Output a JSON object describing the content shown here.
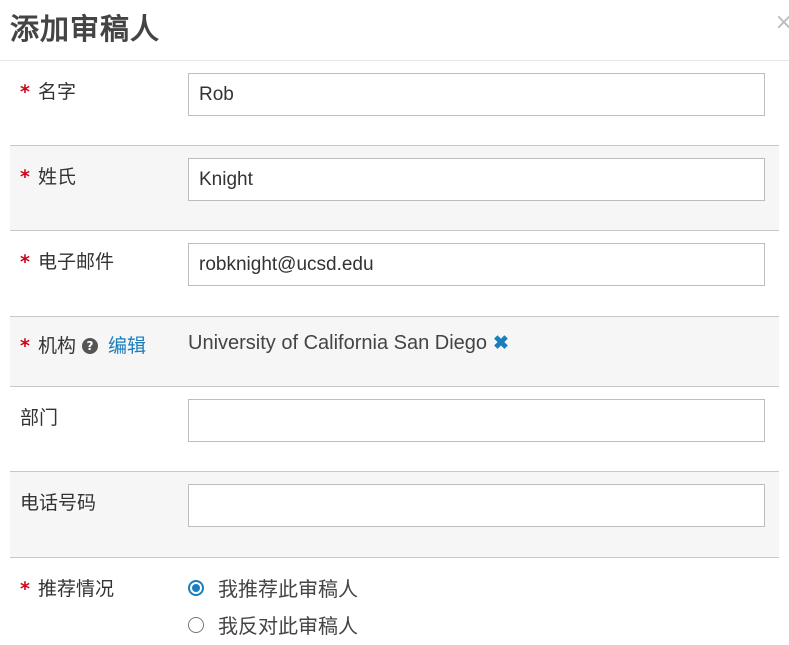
{
  "dialog": {
    "title": "添加审稿人",
    "close_glyph": "×"
  },
  "required_mark": "*",
  "fields": {
    "first_name": {
      "label": "名字",
      "value": "Rob"
    },
    "last_name": {
      "label": "姓氏",
      "value": "Knight"
    },
    "email": {
      "label": "电子邮件",
      "value": "robknight@ucsd.edu"
    },
    "institution": {
      "label": "机构",
      "help": "?",
      "edit_label": "编辑",
      "value": "University of California San Diego",
      "remove_glyph": "✖"
    },
    "department": {
      "label": "部门",
      "value": ""
    },
    "phone": {
      "label": "电话号码",
      "value": ""
    }
  },
  "recommendation": {
    "label": "推荐情况",
    "options": [
      {
        "label": "我推荐此审稿人",
        "checked": true
      },
      {
        "label": "我反对此审稿人",
        "checked": false
      }
    ]
  },
  "colors": {
    "required": "#d0021b",
    "link": "#1a7dbd",
    "alt_row": "#f6f6f6"
  }
}
